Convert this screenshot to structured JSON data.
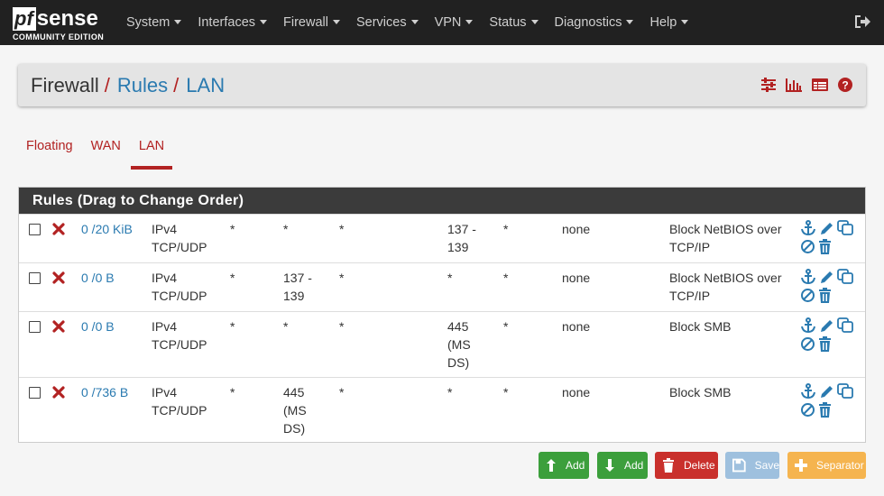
{
  "brand": {
    "logo_pf": "pf",
    "logo_sense": "sense",
    "edition": "COMMUNITY EDITION"
  },
  "nav": {
    "items": [
      "System",
      "Interfaces",
      "Firewall",
      "Services",
      "VPN",
      "Status",
      "Diagnostics",
      "Help"
    ]
  },
  "breadcrumb": {
    "part1": "Firewall",
    "part2": "Rules",
    "part3": "LAN",
    "separator": "/"
  },
  "tabs": [
    "Floating",
    "WAN",
    "LAN"
  ],
  "active_tab": "LAN",
  "rules_panel": {
    "title": "Rules (Drag to Change Order)"
  },
  "rules": [
    {
      "states": "0 /20 KiB",
      "protocol": [
        "IPv4",
        "TCP/UDP"
      ],
      "source": "*",
      "source_port": [
        "*"
      ],
      "destination": "*",
      "dest_port": [
        "137 -",
        "139"
      ],
      "gateway": "*",
      "queue": "none",
      "description": [
        "Block NetBIOS over",
        "TCP/IP"
      ]
    },
    {
      "states": "0 /0 B",
      "protocol": [
        "IPv4",
        "TCP/UDP"
      ],
      "source": "*",
      "source_port": [
        "137 -",
        "139"
      ],
      "destination": "*",
      "dest_port": [
        "*"
      ],
      "gateway": "*",
      "queue": "none",
      "description": [
        "Block NetBIOS over",
        "TCP/IP"
      ]
    },
    {
      "states": "0 /0 B",
      "protocol": [
        "IPv4",
        "TCP/UDP"
      ],
      "source": "*",
      "source_port": [
        "*"
      ],
      "destination": "*",
      "dest_port": [
        "445",
        "(MS",
        "DS)"
      ],
      "gateway": "*",
      "queue": "none",
      "description": [
        "Block SMB"
      ]
    },
    {
      "states": "0 /736 B",
      "protocol": [
        "IPv4",
        "TCP/UDP"
      ],
      "source": "*",
      "source_port": [
        "445",
        "(MS",
        "DS)"
      ],
      "destination": "*",
      "dest_port": [
        "*"
      ],
      "gateway": "*",
      "queue": "none",
      "description": [
        "Block SMB"
      ]
    }
  ],
  "buttons": {
    "add_top": "Add",
    "add_bottom": "Add",
    "delete": "Delete",
    "save": "Save",
    "separator": "Separator"
  },
  "colors": {
    "navbar": "#212121",
    "accent_red": "#b22222",
    "link_blue": "#2a7ab0",
    "success": "#3c9f3c",
    "danger": "#c9302c",
    "save_disabled": "#9ec0de",
    "warning": "#f5b44f"
  }
}
